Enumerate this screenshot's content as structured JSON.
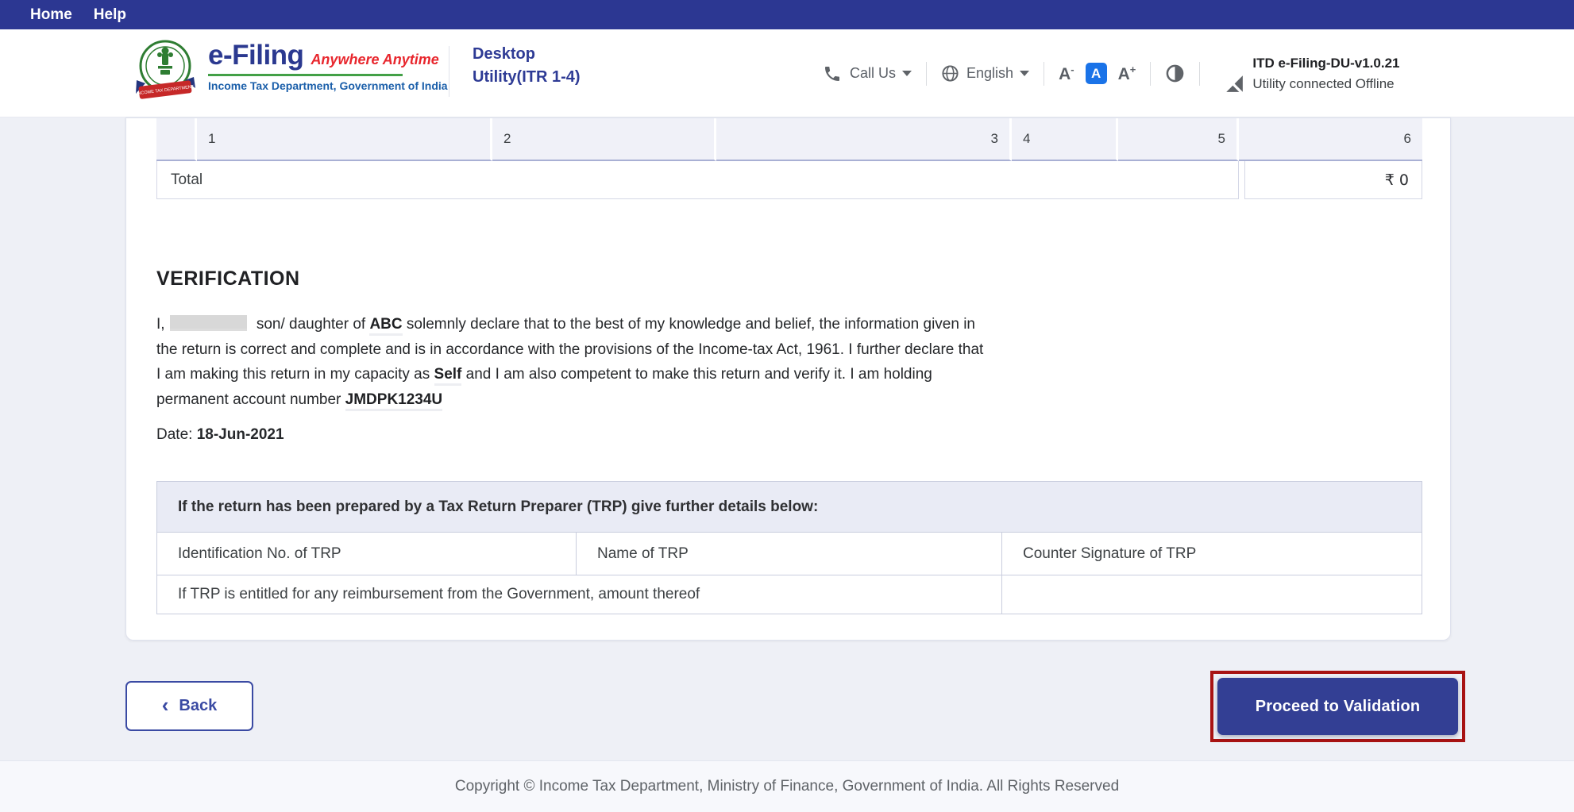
{
  "topnav": {
    "items": [
      {
        "label": "Home"
      },
      {
        "label": "Help"
      }
    ]
  },
  "header": {
    "logo": {
      "brand": "e-Filing",
      "tagline": "Anywhere Anytime",
      "org": "Income Tax Department, Government of India"
    },
    "app_title": {
      "line1": "Desktop",
      "line2": "Utility(ITR 1-4)"
    },
    "call_us_label": "Call Us",
    "language_label": "English",
    "font_controls": {
      "letter": "A",
      "minus": "-",
      "plus": "+"
    },
    "version": "ITD e-Filing-DU-v1.0.21",
    "connection_status": "Utility connected Offline"
  },
  "summary_table": {
    "columns": [
      "",
      "1",
      "2",
      "3",
      "4",
      "5",
      "6"
    ],
    "total_label": "Total",
    "total_value": "₹ 0"
  },
  "verification": {
    "heading": "VERIFICATION",
    "intro": "I,",
    "after_name": "son/ daughter of",
    "father_name": "ABC",
    "declaration_1": "solemnly declare that to the best of my knowledge and belief, the information given in the return is correct and complete and is in accordance with the provisions of the Income-tax Act, 1961. I further declare that I am making this return in my capacity as",
    "capacity": "Self",
    "declaration_2": "and I am also competent to make this return and verify it. I am holding permanent account number",
    "pan": "JMDPK1234U",
    "date_label": "Date:",
    "date_value": "18-Jun-2021"
  },
  "trp_table": {
    "header": "If the return has been prepared by a Tax Return Preparer (TRP) give further details below:",
    "col1": "Identification No. of TRP",
    "col2": "Name of TRP",
    "col3": "Counter Signature of TRP",
    "reimbursement_label": "If TRP is entitled for any reimbursement from the Government, amount thereof"
  },
  "actions": {
    "back_chevron": "‹",
    "back_label": "Back",
    "proceed_label": "Proceed to Validation"
  },
  "footer": {
    "copyright": "Copyright © Income Tax Department, Ministry of Finance, Government of India. All Rights Reserved"
  },
  "colors": {
    "nav_blue": "#2c3792",
    "button_blue": "#333f94",
    "highlight_red": "#a81313",
    "font_active_blue": "#1a73e8",
    "brand_blue": "#2b3990",
    "tagline_red": "#e8262d",
    "rule_green": "#43a047"
  }
}
